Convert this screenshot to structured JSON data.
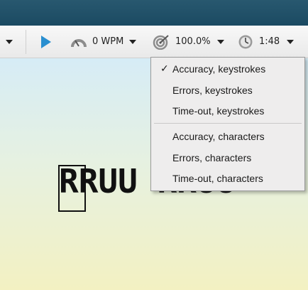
{
  "toolbar": {
    "play_icon": "play-icon",
    "speed_icon": "speedometer-icon",
    "speed_label": "0 WPM",
    "accuracy_icon": "target-icon",
    "accuracy_label": "100.0%",
    "timer_icon": "clock-icon",
    "timer_label": "1:48",
    "accent": "#2a8fd0"
  },
  "content": {
    "practice_text": "RRUU RRUU"
  },
  "menu": {
    "items": [
      {
        "label": "Accuracy, keystrokes",
        "checked": true
      },
      {
        "label": "Errors, keystrokes",
        "checked": false
      },
      {
        "label": "Time-out, keystrokes",
        "checked": false
      },
      {
        "label": "Accuracy, characters",
        "checked": false
      },
      {
        "label": "Errors, characters",
        "checked": false
      },
      {
        "label": "Time-out, characters",
        "checked": false
      }
    ],
    "check_glyph": "✓"
  }
}
